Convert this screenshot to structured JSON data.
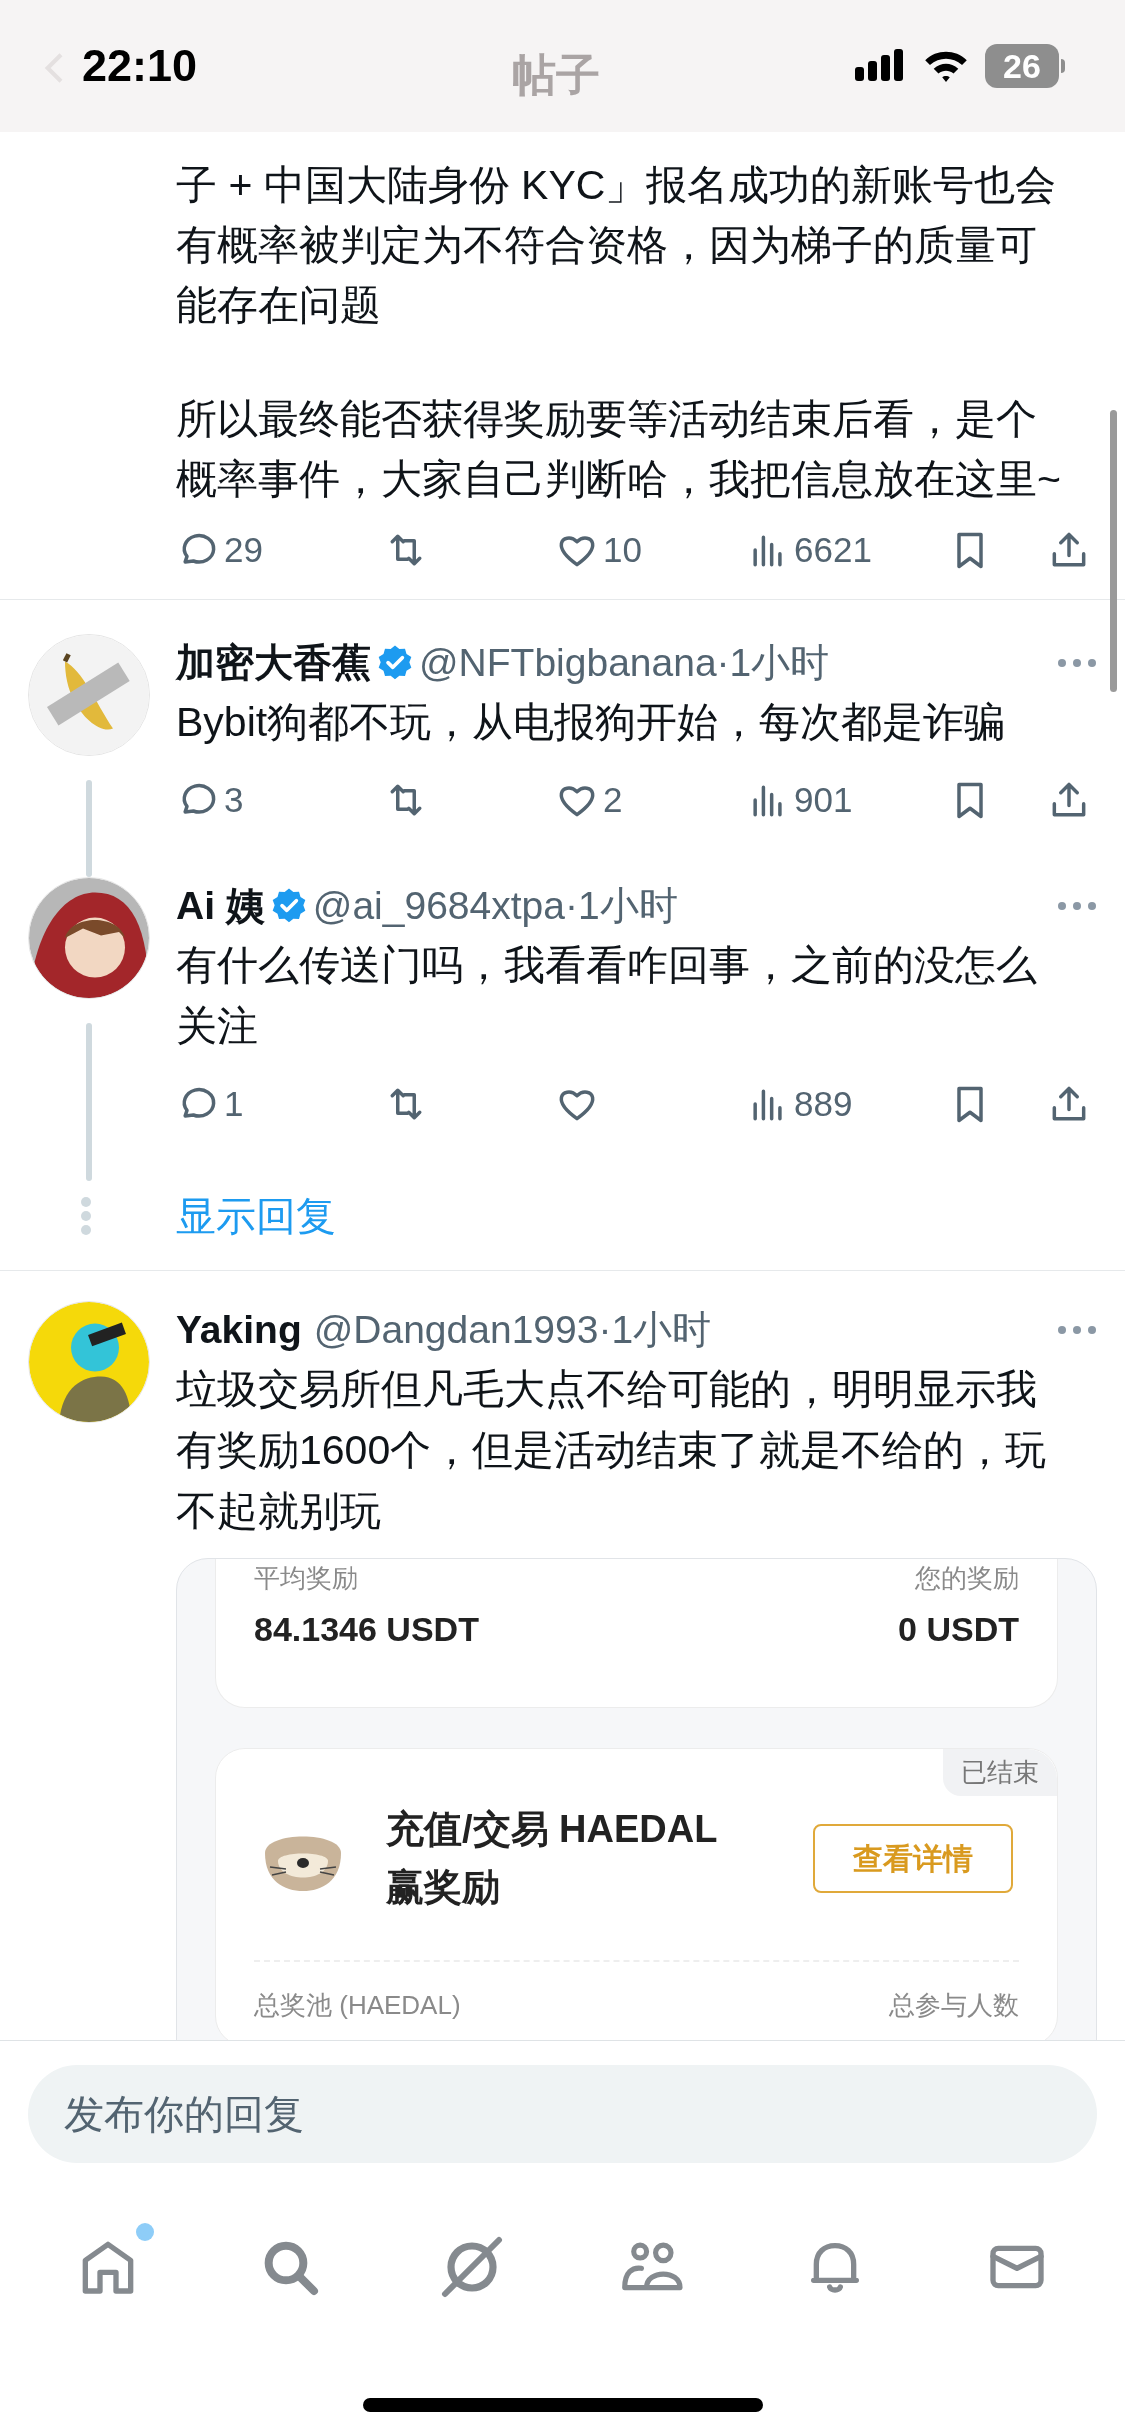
{
  "status_bar": {
    "time": "22:10",
    "battery": "26"
  },
  "header": {
    "title": "帖子"
  },
  "post_tail": {
    "paragraphs": [
      "子 + 中国大陆身份 KYC」报名成功的新账号也会有概率被判定为不符合资格，因为梯子的质量可能存在问题",
      "所以最终能否获得奖励要等活动结束后看，是个概率事件，大家自己判断哈，我把信息放在这里~"
    ],
    "stats": {
      "replies": "29",
      "likes": "10",
      "views": "6621"
    }
  },
  "replies": [
    {
      "name": "加密大香蕉",
      "verified": true,
      "handle": "@NFTbigbanana",
      "separator": "·",
      "time": "1小时",
      "text": "Bybit狗都不玩，从电报狗开始，每次都是诈骗",
      "thread_line": true,
      "stats": {
        "replies": "3",
        "likes": "2",
        "views": "901"
      }
    },
    {
      "name": "Ai 姨",
      "verified": true,
      "handle": "@ai_9684xtpa",
      "separator": "·",
      "time": "1小时",
      "text": "有什么传送门吗，我看看咋回事，之前的没怎么关注",
      "thread_line": true,
      "stats": {
        "replies": "1",
        "views": "889"
      }
    }
  ],
  "show_replies": "显示回复",
  "last_reply": {
    "name": "Yaking",
    "verified": false,
    "handle": "@Dangdan1993",
    "separator": "·",
    "time": "1小时",
    "text": "垃圾交易所但凡毛大点不给可能的，明明显示我有奖励1600个，但是活动结束了就是不给的，玩不起就别玩",
    "image": {
      "avg_label": "平均奖励",
      "avg_value": "84.1346 USDT",
      "your_label": "您的奖励",
      "your_value": "0 USDT",
      "status": "已结束",
      "title": "充值/交易 HAEDAL 赢奖励",
      "button": "查看详情",
      "pool_label": "总奖池 (HAEDAL)",
      "participants_label": "总参与人数"
    }
  },
  "reply_field": {
    "placeholder": "发布你的回复"
  },
  "tabs": [
    {
      "kind": "home",
      "badge": true
    },
    {
      "kind": "search",
      "badge": false
    },
    {
      "kind": "grok",
      "badge": false
    },
    {
      "kind": "communities",
      "badge": false
    },
    {
      "kind": "notifications",
      "badge": false
    },
    {
      "kind": "messages",
      "badge": false
    }
  ]
}
